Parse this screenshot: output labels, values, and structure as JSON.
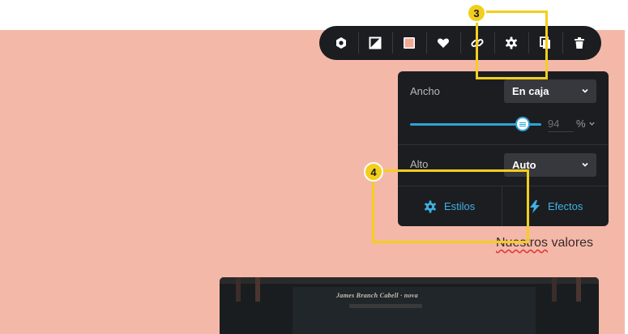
{
  "toolbar": {
    "buttons": [
      {
        "name": "hexagon-icon"
      },
      {
        "name": "contrast-icon"
      },
      {
        "name": "color-swatch-icon",
        "color": "#f4b8a9"
      },
      {
        "name": "heart-icon"
      },
      {
        "name": "link-icon"
      },
      {
        "name": "gear-icon"
      },
      {
        "name": "duplicate-icon"
      },
      {
        "name": "trash-icon"
      }
    ]
  },
  "panel": {
    "width_label": "Ancho",
    "width_value": "En caja",
    "slider_value": "94",
    "slider_unit": "%",
    "height_label": "Alto",
    "height_value": "Auto",
    "tabs": {
      "styles": "Estilos",
      "effects": "Efectos"
    }
  },
  "annotations": {
    "badge_1": "3",
    "badge_2": "4",
    "highlight_color": "#f2cf1d"
  },
  "page": {
    "heading_part1": "Nuestros",
    "heading_part2": " valores",
    "background_color": "#f4b8a9",
    "book_title": "James Branch Cabell · nova"
  },
  "colors": {
    "accent": "#3eb2e5",
    "panel_bg": "#1c1d21"
  }
}
